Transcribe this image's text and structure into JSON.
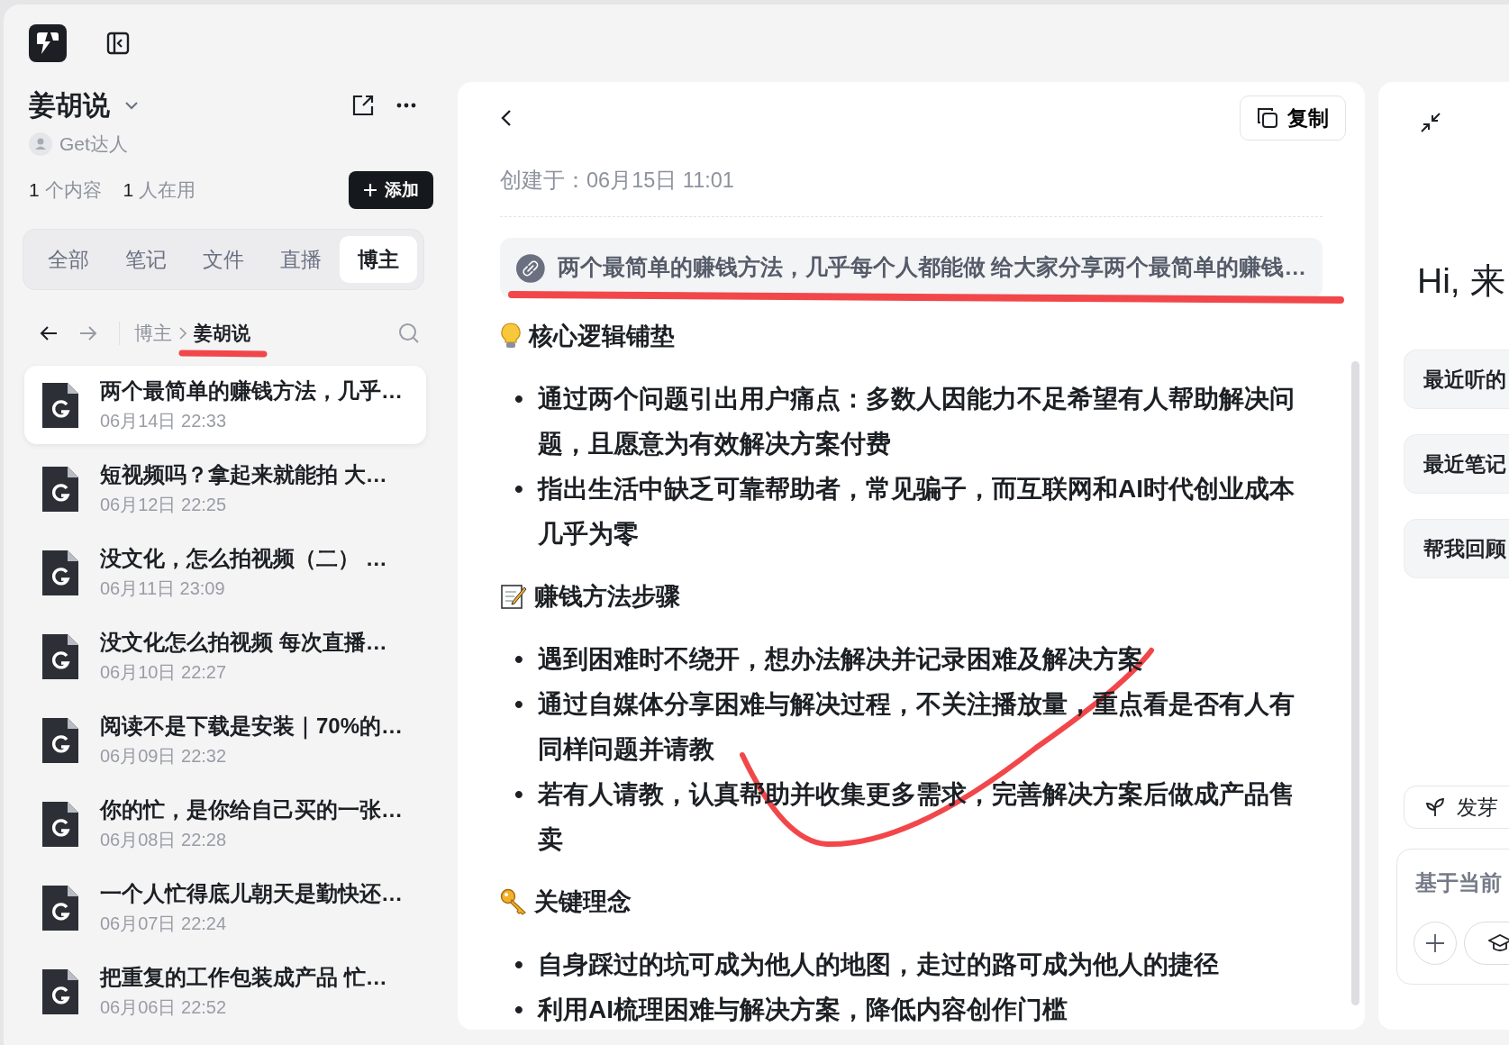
{
  "space": {
    "title": "姜胡说",
    "owner": "Get达人",
    "content_count": "1",
    "content_label": "个内容",
    "user_count": "1",
    "user_label": "人在用",
    "add_button": "添加"
  },
  "tabs": [
    {
      "label": "全部",
      "selected": false
    },
    {
      "label": "笔记",
      "selected": false
    },
    {
      "label": "文件",
      "selected": false
    },
    {
      "label": "直播",
      "selected": false
    },
    {
      "label": "博主",
      "selected": true
    }
  ],
  "breadcrumb": [
    "博主",
    "姜胡说"
  ],
  "items": [
    {
      "title": "两个最简单的赚钱方法，几乎…",
      "date": "06月14日 22:33",
      "selected": true
    },
    {
      "title": "短视频吗？拿起来就能拍 大…",
      "date": "06月12日 22:25",
      "selected": false
    },
    {
      "title": "没文化，怎么拍视频（二） …",
      "date": "06月11日 23:09",
      "selected": false
    },
    {
      "title": "没文化怎么拍视频 每次直播…",
      "date": "06月10日 22:27",
      "selected": false
    },
    {
      "title": "阅读不是下载是安装｜70%的…",
      "date": "06月09日 22:32",
      "selected": false
    },
    {
      "title": "你的忙，是你给自己买的一张…",
      "date": "06月08日 22:28",
      "selected": false
    },
    {
      "title": "一个人忙得底儿朝天是勤快还…",
      "date": "06月07日 22:24",
      "selected": false
    },
    {
      "title": "把重复的工作包装成产品 忙…",
      "date": "06月06日 22:52",
      "selected": false
    }
  ],
  "note": {
    "copy_button": "复制",
    "created_label": "创建于：",
    "created": "06月15日 11:01",
    "link": "两个最简单的赚钱方法，几乎每个人都能做 给大家分享两个最简单的赚钱…",
    "bullet": "•",
    "sections": [
      {
        "kind": "bulb",
        "heading": "核心逻辑铺垫",
        "bullets": [
          "通过两个问题引出用户痛点：多数人因能力不足希望有人帮助解决问题，且愿意为有效解决方案付费",
          "指出生活中缺乏可靠帮助者，常见骗子，而互联网和AI时代创业成本几乎为零"
        ]
      },
      {
        "kind": "memo",
        "heading": "赚钱方法步骤",
        "bullets": [
          "遇到困难时不绕开，想办法解决并记录困难及解决方案",
          "通过自媒体分享困难与解决过程，不关注播放量，重点看是否有人有同样问题并请教",
          "若有人请教，认真帮助并收集更多需求，完善解决方案后做成产品售卖"
        ]
      },
      {
        "kind": "key",
        "heading": "关键理念",
        "bullets": [
          "自身踩过的坑可成为他人的地图，走过的路可成为他人的捷径",
          "利用AI梳理困难与解决方案，降低内容创作门槛"
        ]
      }
    ]
  },
  "assistant": {
    "greeting": "Hi, 来",
    "suggestions": [
      "最近听的",
      "最近笔记",
      "帮我回顾"
    ],
    "chip": "发芽",
    "placeholder": "基于当前"
  }
}
